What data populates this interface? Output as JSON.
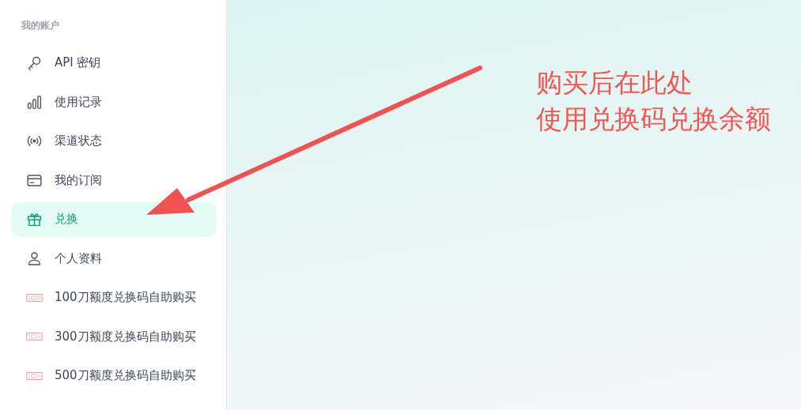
{
  "sidebar": {
    "heading": "我的账户",
    "items": [
      {
        "label": "API 密钥",
        "selected": false
      },
      {
        "label": "使用记录",
        "selected": false
      },
      {
        "label": "渠道状态",
        "selected": false
      },
      {
        "label": "我的订阅",
        "selected": false
      },
      {
        "label": "兑换",
        "selected": true
      },
      {
        "label": "个人资料",
        "selected": false
      },
      {
        "label": "100刀额度兑换码自助购买",
        "selected": false
      },
      {
        "label": "300刀额度兑换码自助购买",
        "selected": false
      },
      {
        "label": "500刀额度兑换码自助购买",
        "selected": false
      }
    ]
  },
  "annotation": {
    "lines": [
      "购买后在此处",
      "使用兑换码兑换余额"
    ]
  }
}
